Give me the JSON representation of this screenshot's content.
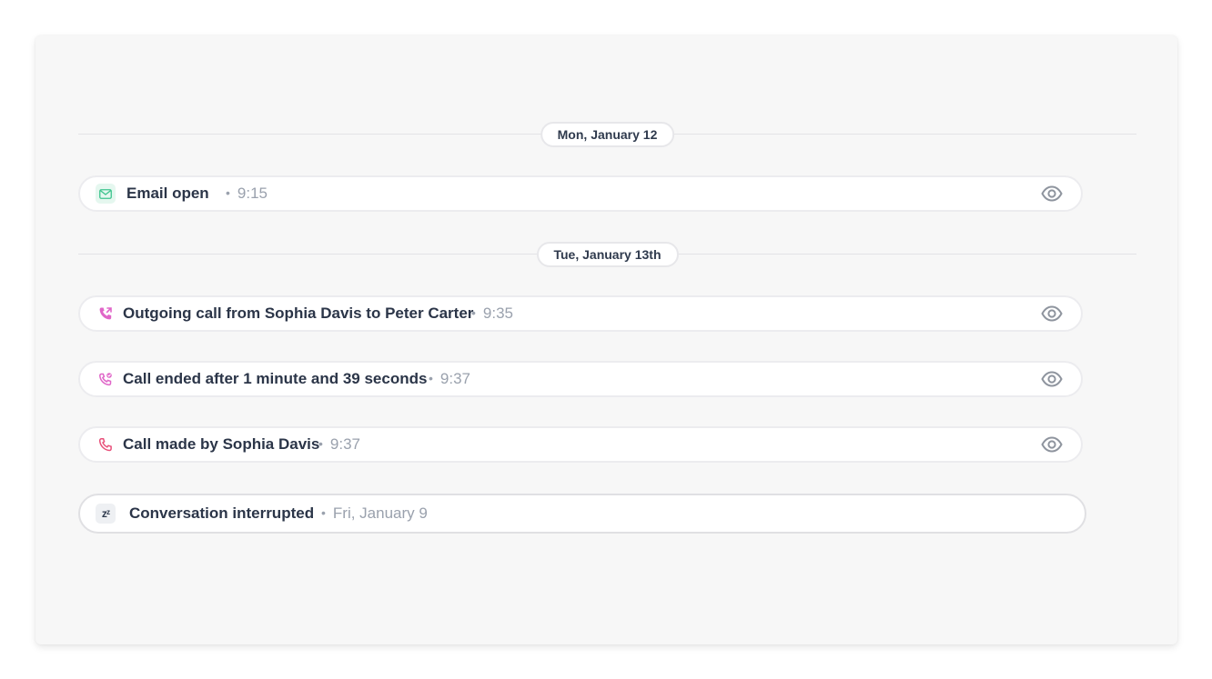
{
  "timeline": {
    "dividers": [
      {
        "label": "Mon, January 12"
      },
      {
        "label": "Tue, January 13th"
      }
    ],
    "events": [
      {
        "icon": "email-icon",
        "label": "Email open",
        "separator": "•",
        "time": "9:15"
      },
      {
        "icon": "outgoing-call-icon",
        "label": "Outgoing call from Sophia Davis to Peter Carter",
        "separator": "•",
        "time": "9:35"
      },
      {
        "icon": "call-ended-icon",
        "label": "Call ended after 1 minute and 39 seconds",
        "separator": "•",
        "time": "9:37"
      },
      {
        "icon": "phone-icon",
        "label": "Call made by Sophia Davis",
        "separator": "•",
        "time": "9:37"
      },
      {
        "icon": "snooze-icon",
        "icon_text": "zᶻ",
        "label": "Conversation interrupted",
        "separator": "•",
        "time": "Fri, January 9"
      }
    ]
  },
  "colors": {
    "email_icon": "#3ec48e",
    "call_icon": "#e066c8",
    "phone_icon": "#e8507a",
    "eye_icon": "#8e949e"
  }
}
